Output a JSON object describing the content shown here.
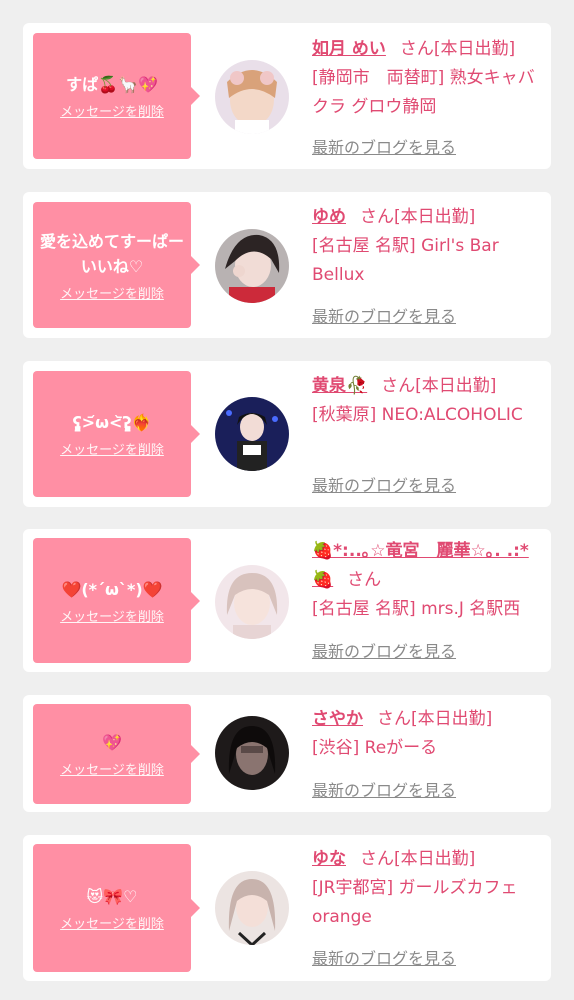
{
  "delete_label": "メッセージを削除",
  "blog_label": "最新のブログを見る",
  "san_label": "さん",
  "colors": {
    "accent": "#e04a72",
    "bubble": "#ff8fa4",
    "card": "#ffffff",
    "background": "#efefef",
    "muted": "#8a8a8a"
  },
  "entries": [
    {
      "message": "すぱ🍒🦙💖",
      "name": "如月 めい",
      "status": "[本日出勤]",
      "shop": "[静岡市　両替町] 熟女キャバクラ グロウ静岡"
    },
    {
      "message": "愛を込めてすーぱーいいね♡",
      "name": "ゆめ",
      "status": "[本日出勤]",
      "shop": "[名古屋 名駅] Girl's Bar Bellux"
    },
    {
      "message": "ʕ̡̢̡>᷄ω<᷅ʔ̡̢̡❤️‍🔥",
      "name": "黄泉🥀",
      "status": "[本日出勤]",
      "shop": "[秋葉原] NEO:ALCOHOLIC"
    },
    {
      "message": "❤️(*´ω`*)❤️",
      "name": "🍓*:..｡☆竜宮　麗華☆｡. .:*🍓",
      "status": "",
      "shop": "[名古屋 名駅] mrs.J 名駅西"
    },
    {
      "message": "💖",
      "name": "さやか",
      "status": "[本日出勤]",
      "shop": "[渋谷] Reがーる"
    },
    {
      "message": "😻🎀♡",
      "name": "ゆな",
      "status": "[本日出勤]",
      "shop": "[JR宇都宮] ガールズカフェ orange"
    }
  ]
}
